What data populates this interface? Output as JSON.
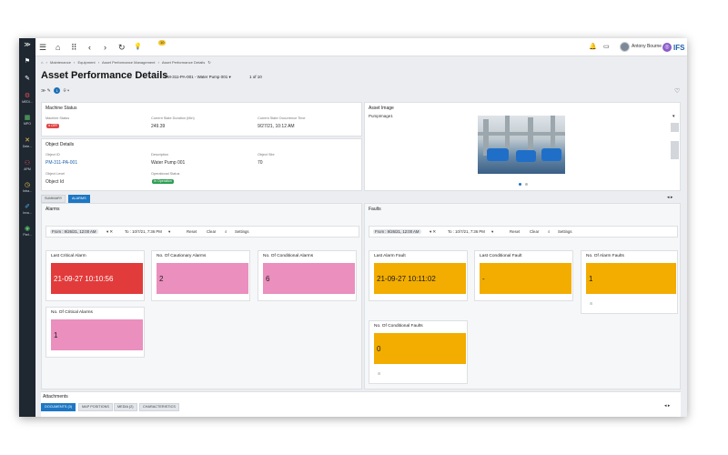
{
  "rail": [
    {
      "icon": "≫",
      "label": "",
      "name": "expand-icon"
    },
    {
      "icon": "⚑",
      "label": "",
      "name": "bookmark-icon"
    },
    {
      "icon": "✎",
      "label": "",
      "name": "pencil-icon"
    },
    {
      "icon": "⚙",
      "label": "MEDI...",
      "name": "medi-icon"
    },
    {
      "icon": "▦",
      "label": "MPO",
      "name": "mpo-icon"
    },
    {
      "icon": "✕",
      "label": "Dete...",
      "name": "dete-icon"
    },
    {
      "icon": "⚇",
      "label": "APM",
      "name": "apm-icon"
    },
    {
      "icon": "◷",
      "label": "Intra...",
      "name": "intra-icon"
    },
    {
      "icon": "✐",
      "label": "Inva...",
      "name": "inva-icon"
    },
    {
      "icon": "◉",
      "label": "Part...",
      "name": "part-icon"
    }
  ],
  "topbar": {
    "menu_icon": "☰",
    "home_icon": "⌂",
    "apps_icon": "⠿",
    "back_icon": "‹",
    "forward_icon": "›",
    "refresh_icon": "↻",
    "lightbulb_icon": "💡",
    "notification_count": "10",
    "bell_icon": "🔔",
    "chat_icon": "▭",
    "user_name": "Antony Bourne",
    "brand": "IFS"
  },
  "breadcrumb": [
    "⌂",
    "›",
    "Maintenance",
    "›",
    "Equipment",
    "›",
    "Asset Performance Management",
    "›",
    "Asset Performance Details",
    "↻"
  ],
  "page": {
    "title": "Asset Performance Details",
    "record": "PM-311-PA-001 - Water Pump 001 ▾",
    "count": "1 of 10",
    "toolrow": "≫  ✎",
    "toolrow_badge": "1",
    "toolrow_more": "⌾ ▾",
    "heart_icon": "♡"
  },
  "machine_status": {
    "title": "Machine Status",
    "labels": [
      "Machine Status",
      "Current State Duration (Min)",
      "Current State Occurrence Time"
    ],
    "status_pill": "● OFF",
    "duration": "249.39",
    "occurrence": "9/27/21, 10:12 AM"
  },
  "object_details": {
    "title": "Object Details",
    "labels": [
      "Object ID",
      "Description",
      "Object Site",
      "Object Level",
      "Operational Status"
    ],
    "object_id": "PM-311-PA-001",
    "description": "Water Pump 001",
    "site": "70",
    "level": "Object Id",
    "operational": "In Operation"
  },
  "asset_image": {
    "title": "Asset Image",
    "selected": "PumpImage1",
    "chevron": "▾"
  },
  "tabs": [
    "SUMMARY",
    "ALARMS"
  ],
  "tab_nav": "◂ ▸",
  "alarms": {
    "title": "Alarms",
    "from": "From : 9/26/21, 12:00 AM",
    "from_ctrl": "▾ ✕",
    "to": "To : 10/7/21, 7:36 PM",
    "to_ctrl": "▾",
    "reset": "Reset",
    "clear": "Clear",
    "settings": "Settings",
    "search_icon": "⌕",
    "kpis": [
      {
        "title": "Last Critical Alarm",
        "value": "21-09-27 10:10:56",
        "color": "red"
      },
      {
        "title": "No. Of Cautionary Alarms",
        "value": "2",
        "color": "pink"
      },
      {
        "title": "No. Of Conditional Alarms",
        "value": "6",
        "color": "pink"
      },
      {
        "title": "No. Of Critical Alarms",
        "value": "1",
        "color": "pink"
      }
    ]
  },
  "faults": {
    "title": "Faults",
    "from": "From : 9/26/21, 12:00 AM",
    "from_ctrl": "▾ ✕",
    "to": "To : 10/7/21, 7:36 PM",
    "to_ctrl": "▾",
    "reset": "Reset",
    "clear": "Clear",
    "settings": "Settings",
    "search_icon": "⌕",
    "kpis": [
      {
        "title": "Last Alarm Fault",
        "value": "21-09-27 10:11:02",
        "color": "amber"
      },
      {
        "title": "Last Conditional Fault",
        "value": "-",
        "color": "amber"
      },
      {
        "title": "No. Of Alarm Faults",
        "value": "1",
        "color": "amber",
        "foot": "⊞"
      },
      {
        "title": "No. Of Conditional Faults",
        "value": "0",
        "color": "amber",
        "foot": "⊞"
      }
    ]
  },
  "attachments": {
    "title": "Attachments",
    "tabs": [
      "DOCUMENTS (3)",
      "MAP POSITIONS",
      "MEDIA (2)",
      "CHARACTERISTICS"
    ],
    "nav": "◂ ▸"
  },
  "colors": {
    "rail": "#1f2731",
    "accent": "#1d77c3",
    "critical": "#e23b3b",
    "pink": "#ea8fbe",
    "amber": "#f2ad00",
    "off": "#e04646",
    "operational": "#2f9e52"
  }
}
